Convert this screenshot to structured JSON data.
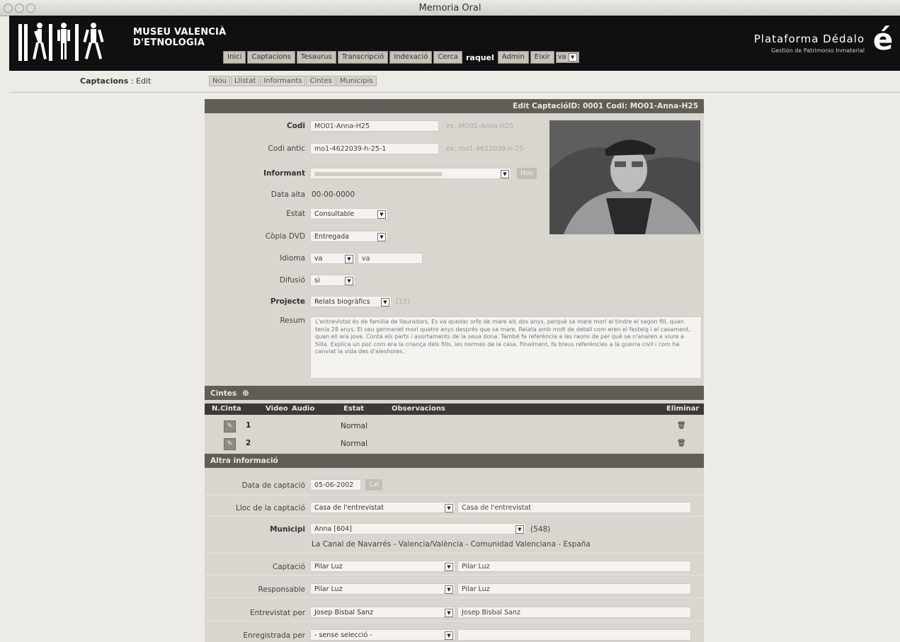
{
  "window": {
    "title": "Memoria Oral"
  },
  "header": {
    "museum_name_line1": "MUSEU VALENCIÀ",
    "museum_name_line2": "D'ETNOLOGIA",
    "nav": {
      "inici": "Inici",
      "captacions": "Captacions",
      "tesaurus": "Tesaurus",
      "transcripcio": "Transcripció",
      "indexacio": "Indexació",
      "cerca": "Cerca",
      "user": "raquel",
      "admin": "Admin",
      "eixir": "Eixir",
      "lang": "va"
    },
    "brand_title": "Plataforma Dédalo",
    "brand_subtitle": "Gestión de Patrimonio Inmaterial",
    "brand_logo_letter": "é"
  },
  "subbar": {
    "section": "Captacions",
    "separator": " : ",
    "mode": "Edit",
    "nav": {
      "nou": "Nou",
      "llistat": "Llistat",
      "informants": "Informants",
      "cintes": "Cintes",
      "municipis": "Municipis"
    }
  },
  "record": {
    "header": "Edit CaptacióID: 0001   Codi: MO01-Anna-H25",
    "codi": {
      "label": "Codi",
      "value": "MO01-Anna-H25",
      "hint": "ex. MO01-Anna-H25"
    },
    "codi_antic": {
      "label": "Codi antic",
      "value": "mo1-4622039-h-25-1",
      "hint": "ex. mo1-4622039-h-25"
    },
    "informant": {
      "label": "Informant",
      "value": "",
      "button": "Nou"
    },
    "data_alta": {
      "label": "Data alta",
      "value": "00-00-0000"
    },
    "estat": {
      "label": "Estat",
      "value": "Consultable"
    },
    "copia_dvd": {
      "label": "Còpia DVD",
      "value": "Entregada"
    },
    "idioma": {
      "label": "Idioma",
      "value": "va",
      "text": "va"
    },
    "difusio": {
      "label": "Difusió",
      "value": "si"
    },
    "projecte": {
      "label": "Projecte",
      "value": "Relats biogràfics",
      "count": "[12]"
    },
    "resum": {
      "label": "Resum",
      "text": "L'entrevistat és de família de llauradors. Es va quedar orfe de mare als dos anys, perquè sa mare morí al tindre el segon fill, quan tenia 28 anys. El seu germanet morí quatre anys després que sa mare. Relata amb molt de detall com eren el festeig i el casament, quan ell era jove. Conta els parts i avortaments de la seua dona. També fa referència a les raons de per què se n'anaren a viure a Silla. Explica un poc com era la criança dels fills, les normes de la casa. Finalment, fa breus referències a la guerra civil i com ha canviat la vida des d'aleshores."
    }
  },
  "cintes": {
    "section_title": "Cintes",
    "columns": {
      "ncinta": "N.Cinta",
      "video": "Video",
      "audio": "Audio",
      "estat": "Estat",
      "observacions": "Observacions",
      "eliminar": "Eliminar"
    },
    "rows": [
      {
        "num": "1",
        "estat": "Normal"
      },
      {
        "num": "2",
        "estat": "Normal"
      }
    ]
  },
  "altra": {
    "section_title": "Altra informació",
    "data_captacio": {
      "label": "Data de captació",
      "value": "05-06-2002",
      "button": "Cal"
    },
    "lloc": {
      "label": "Lloc de la captació",
      "value": "Casa de l'entrevistat",
      "text": "Casa de l'entrevistat"
    },
    "municipi": {
      "label": "Municipi",
      "value": "Anna [604]",
      "code": "(548)",
      "full": "La Canal de Navarrés - Valencia/València - Comunidad Valenciana - España"
    },
    "captacio": {
      "label": "Captació",
      "value": "Pilar Luz",
      "text": "Pilar Luz"
    },
    "responsable": {
      "label": "Responsable",
      "value": "Pilar Luz",
      "text": "Pilar Luz"
    },
    "entrevistat": {
      "label": "Entrevistat per",
      "value": "Josep Bisbal Sanz",
      "text": "Josep Bisbal Sanz"
    },
    "enregistrada": {
      "label": "Enregistrada per",
      "value": "- sense selecció -",
      "text": ""
    }
  },
  "icons": {
    "pencil": "✎",
    "trash": "🗑",
    "add": "⊕",
    "arrow": "▼"
  }
}
